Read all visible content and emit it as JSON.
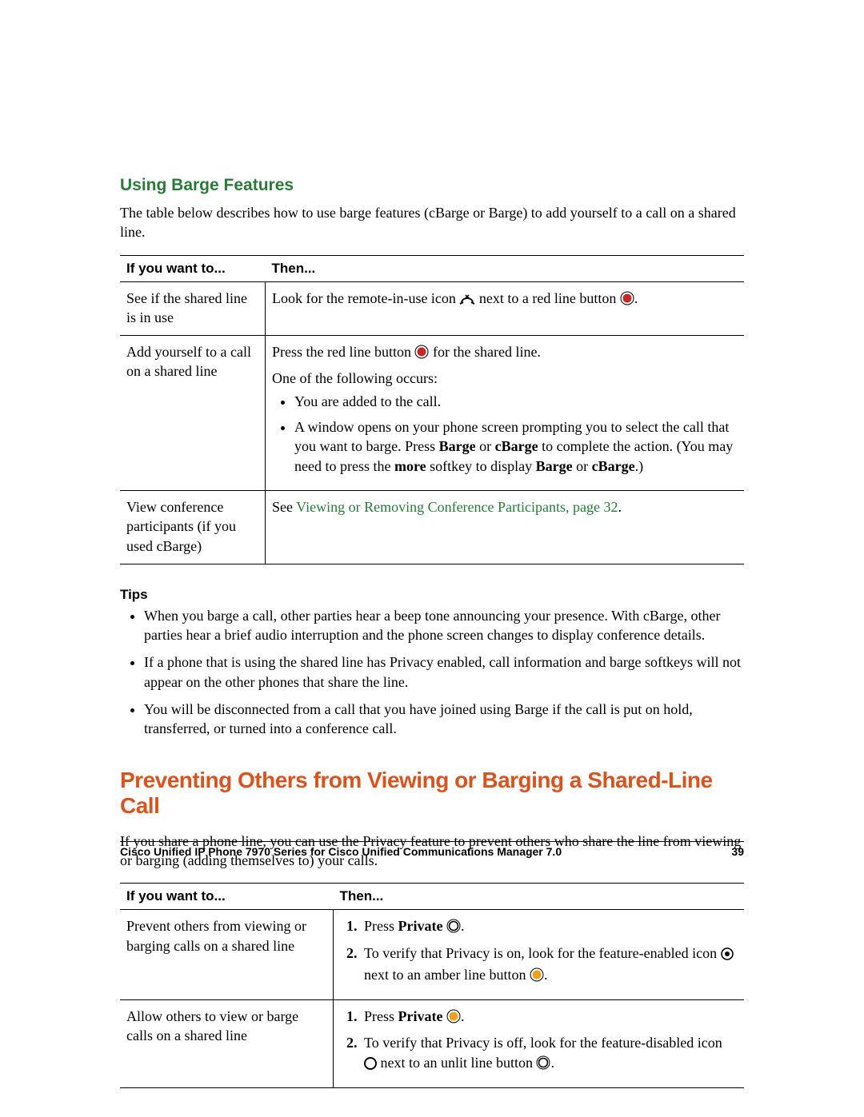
{
  "section_barge": {
    "heading": "Using Barge Features",
    "intro": "The table below describes how to use barge features (cBarge or Barge) to add yourself to a call on a shared line.",
    "col_if": "If you want to...",
    "col_then": "Then...",
    "rows": {
      "r1_if": "See if the shared line is in use",
      "r1_then_a": "Look for the remote-in-use icon ",
      "r1_then_b": " next to a red line button ",
      "r1_then_c": ".",
      "r2_if": "Add yourself to a call on a shared line",
      "r2_then_a": "Press the red line button ",
      "r2_then_b": " for the shared line.",
      "r2_line2": "One of the following occurs:",
      "r2_b1": "You are added to the call.",
      "r2_b2_a": "A window opens on your phone screen prompting you to select the call that you want to barge. Press ",
      "r2_b2_barge": "Barge",
      "r2_b2_or1": " or ",
      "r2_b2_cbarge": "cBarge",
      "r2_b2_b": " to complete the action. (You may need to press the ",
      "r2_b2_more": "more",
      "r2_b2_c": " softkey to display ",
      "r2_b2_barge2": "Barge",
      "r2_b2_or2": " or ",
      "r2_b2_cbarge2": "cBarge",
      "r2_b2_end": ".)",
      "r3_if": "View conference participants (if you used cBarge)",
      "r3_then_a": "See ",
      "r3_link": "Viewing or Removing Conference Participants, page 32",
      "r3_then_b": "."
    }
  },
  "tips": {
    "heading": "Tips",
    "t1": "When you barge a call, other parties hear a beep tone announcing your presence. With cBarge, other parties hear a brief audio interruption and the phone screen changes to display conference details.",
    "t2": "If a phone that is using the shared line has Privacy enabled, call information and barge softkeys will not appear on the other phones that share the line.",
    "t3": "You will be disconnected from a call that you have joined using Barge if the call is put on hold, transferred, or turned into a conference call."
  },
  "section_priv": {
    "heading": "Preventing Others from Viewing or Barging a Shared-Line Call",
    "intro": "If you share a phone line, you can use the Privacy feature to prevent others who share the line from viewing or barging (adding themselves to) your calls.",
    "col_if": "If you want to...",
    "col_then": "Then...",
    "rows": {
      "r1_if": "Prevent others from viewing or barging calls on a shared line",
      "r1_s1_a": "Press ",
      "r1_s1_priv": "Private",
      "r1_s1_b": " ",
      "r1_s1_c": ".",
      "r1_s2_a": "To verify that Privacy is on, look for the feature-enabled icon ",
      "r1_s2_b": " next to an amber line button ",
      "r1_s2_c": ".",
      "r2_if": "Allow others to view or barge calls on a shared line",
      "r2_s1_a": "Press ",
      "r2_s1_priv": "Private",
      "r2_s1_b": " ",
      "r2_s1_c": ".",
      "r2_s2_a": "To verify that Privacy is off, look for the feature-disabled icon ",
      "r2_s2_b": " next to an unlit line button ",
      "r2_s2_c": "."
    }
  },
  "footer": {
    "title": "Cisco Unified IP Phone 7970 Series for Cisco Unified Communications Manager 7.0",
    "page": "39"
  }
}
